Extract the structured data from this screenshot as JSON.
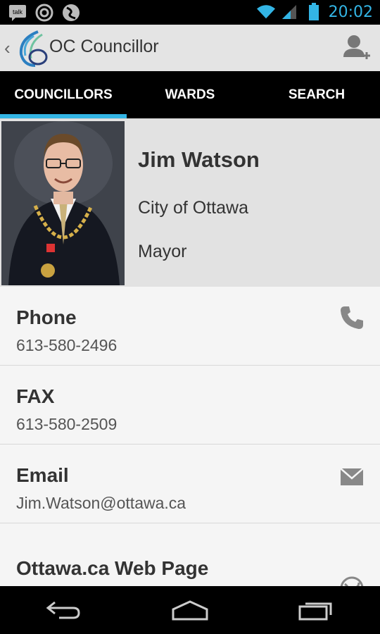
{
  "status_bar": {
    "time": "20:02",
    "notif_icons": [
      "talk-icon",
      "sync-icon",
      "app-icon"
    ],
    "status_icons": [
      "wifi-icon",
      "signal-icon",
      "battery-icon"
    ],
    "time_color": "#33b5e5"
  },
  "action_bar": {
    "title": "OC Councillor",
    "action_icon": "add-contact-icon"
  },
  "tabs": [
    {
      "label": "COUNCILLORS",
      "selected": true
    },
    {
      "label": "WARDS",
      "selected": false
    },
    {
      "label": "SEARCH",
      "selected": false
    }
  ],
  "profile": {
    "name": "Jim Watson",
    "organization": "City of Ottawa",
    "role": "Mayor"
  },
  "contact_rows": [
    {
      "label": "Phone",
      "value": "613-580-2496",
      "icon": "phone-icon"
    },
    {
      "label": "FAX",
      "value": "613-580-2509",
      "icon": ""
    },
    {
      "label": "Email",
      "value": "Jim.Watson@ottawa.ca",
      "icon": "email-icon"
    },
    {
      "label": "Ottawa.ca Web Page",
      "value": "",
      "icon": "globe-icon"
    }
  ],
  "nav_bar": [
    "back-icon",
    "home-icon",
    "recent-apps-icon"
  ],
  "colors": {
    "accent": "#33b5e5",
    "tab_bg": "#000000",
    "action_bar_bg": "#e4e4e4"
  }
}
